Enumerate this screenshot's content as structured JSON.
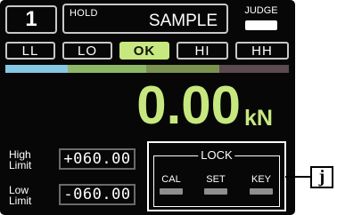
{
  "header": {
    "channel": "1",
    "hold_label": "HOLD",
    "sample_label": "SAMPLE",
    "judge_label": "JUDGE"
  },
  "judgement": {
    "items": [
      {
        "label": "LL"
      },
      {
        "label": "LO"
      },
      {
        "label": "OK",
        "active": true
      },
      {
        "label": "HI"
      },
      {
        "label": "HH"
      }
    ]
  },
  "colors": {
    "strip": [
      "#86c8e3",
      "#8cb867",
      "#7b9150",
      "#5b4a4f"
    ],
    "accent": "#c7e87e"
  },
  "display": {
    "value": "0.00",
    "unit": "kN"
  },
  "limits": {
    "high_label_1": "High",
    "high_label_2": "Limit",
    "high_value": "+060.00",
    "low_label_1": "Low",
    "low_label_2": "Limit",
    "low_value": "-060.00"
  },
  "lock": {
    "title": "LOCK",
    "buttons": [
      "CAL",
      "SET",
      "KEY"
    ]
  },
  "callout": {
    "label": "j"
  }
}
